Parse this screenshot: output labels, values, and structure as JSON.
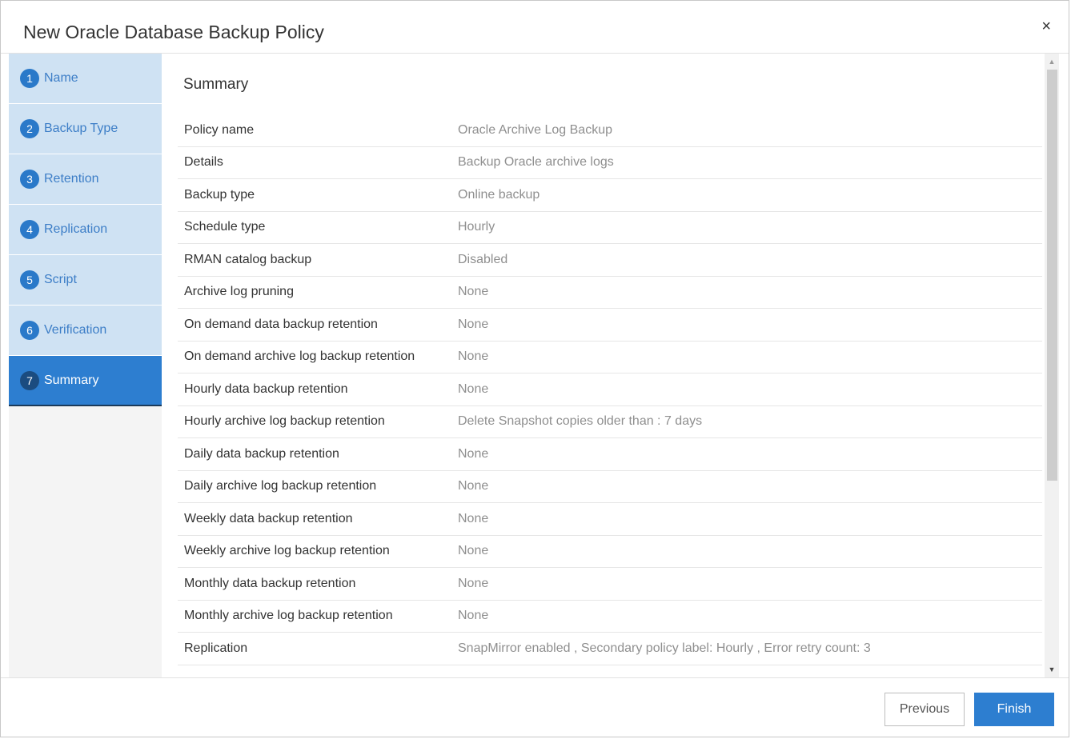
{
  "dialog": {
    "title": "New Oracle Database Backup Policy",
    "close_label": "×"
  },
  "steps": [
    {
      "num": "1",
      "label": "Name"
    },
    {
      "num": "2",
      "label": "Backup Type"
    },
    {
      "num": "3",
      "label": "Retention"
    },
    {
      "num": "4",
      "label": "Replication"
    },
    {
      "num": "5",
      "label": "Script"
    },
    {
      "num": "6",
      "label": "Verification"
    },
    {
      "num": "7",
      "label": "Summary",
      "active": true
    }
  ],
  "summary": {
    "title": "Summary",
    "rows": [
      {
        "label": "Policy name",
        "value": "Oracle Archive Log Backup"
      },
      {
        "label": "Details",
        "value": "Backup Oracle archive logs"
      },
      {
        "label": "Backup type",
        "value": "Online backup"
      },
      {
        "label": "Schedule type",
        "value": "Hourly"
      },
      {
        "label": "RMAN catalog backup",
        "value": "Disabled"
      },
      {
        "label": "Archive log pruning",
        "value": "None"
      },
      {
        "label": "On demand data backup retention",
        "value": "None"
      },
      {
        "label": "On demand archive log backup retention",
        "value": "None"
      },
      {
        "label": "Hourly data backup retention",
        "value": "None"
      },
      {
        "label": "Hourly archive log backup retention",
        "value": "Delete Snapshot copies older than : 7 days"
      },
      {
        "label": "Daily data backup retention",
        "value": "None"
      },
      {
        "label": "Daily archive log backup retention",
        "value": "None"
      },
      {
        "label": "Weekly data backup retention",
        "value": "None"
      },
      {
        "label": "Weekly archive log backup retention",
        "value": "None"
      },
      {
        "label": "Monthly data backup retention",
        "value": "None"
      },
      {
        "label": "Monthly archive log backup retention",
        "value": "None"
      },
      {
        "label": "Replication",
        "value": "SnapMirror enabled , Secondary policy label: Hourly , Error retry count: 3"
      }
    ]
  },
  "footer": {
    "previous_label": "Previous",
    "finish_label": "Finish"
  },
  "colors": {
    "accent": "#2d7ed0",
    "step_bg": "#cfe2f3",
    "value_text": "#8f8f8f"
  }
}
